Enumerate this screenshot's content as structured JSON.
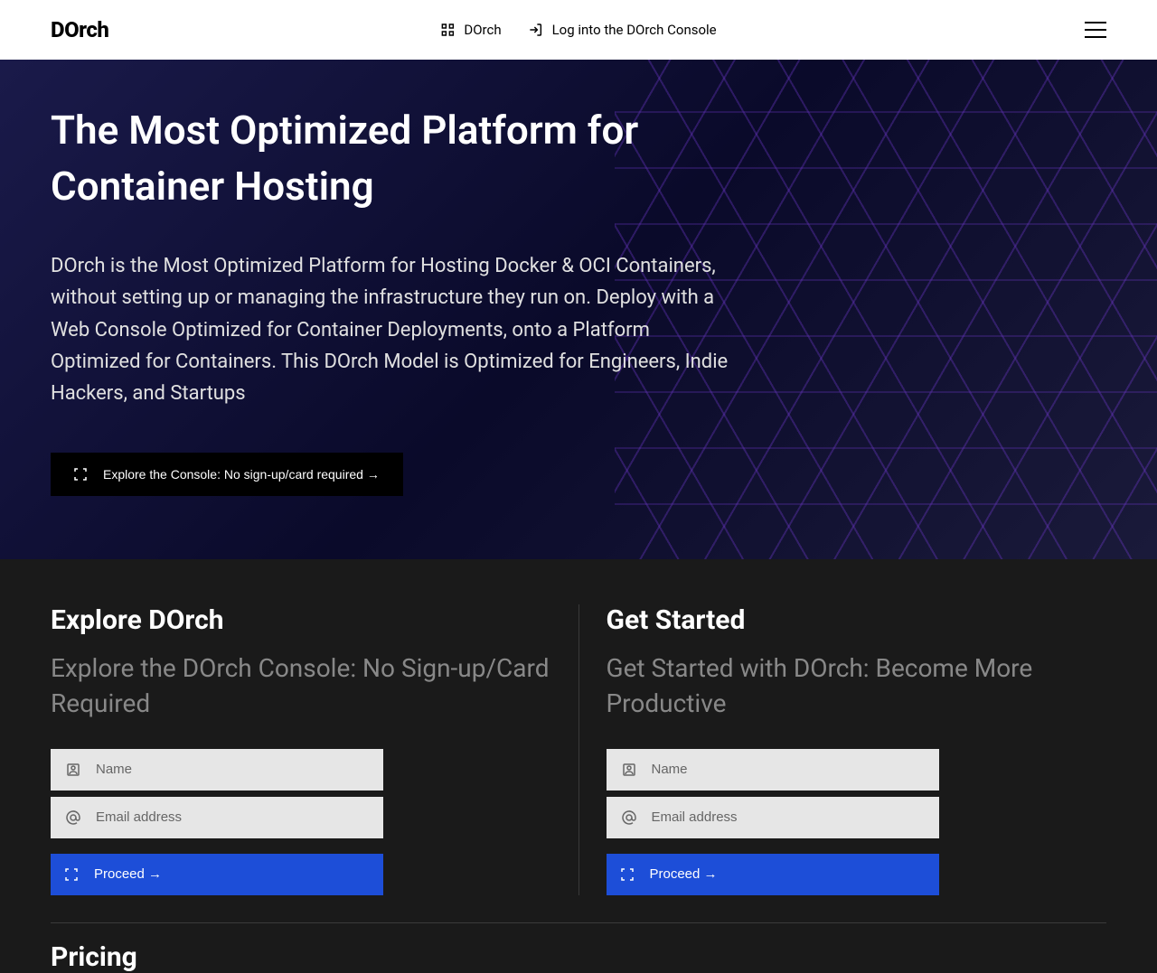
{
  "header": {
    "logo_text": "DOrch",
    "nav_dorch": "DOrch",
    "nav_login": "Log into the DOrch Console"
  },
  "hero": {
    "title": "The Most Optimized Platform for Container Hosting",
    "description": "DOrch is the Most Optimized Platform for Hosting Docker & OCI Containers, without setting up or managing the infrastructure they run on. Deploy with a Web Console Optimized for Container Deployments, onto a Platform Optimized for Containers. This DOrch Model is Optimized for Engineers, Indie Hackers, and Startups",
    "cta_label": "Explore the Console: No sign-up/card required →"
  },
  "columns": {
    "left": {
      "title": "Explore DOrch",
      "subtitle": "Explore the DOrch Console: No Sign-up/Card Required",
      "name_placeholder": "Name",
      "email_placeholder": "Email address",
      "proceed_label": "Proceed →"
    },
    "right": {
      "title": "Get Started",
      "subtitle": "Get Started with DOrch: Become More Productive",
      "name_placeholder": "Name",
      "email_placeholder": "Email address",
      "proceed_label": "Proceed →"
    }
  },
  "pricing": {
    "title": "Pricing"
  }
}
